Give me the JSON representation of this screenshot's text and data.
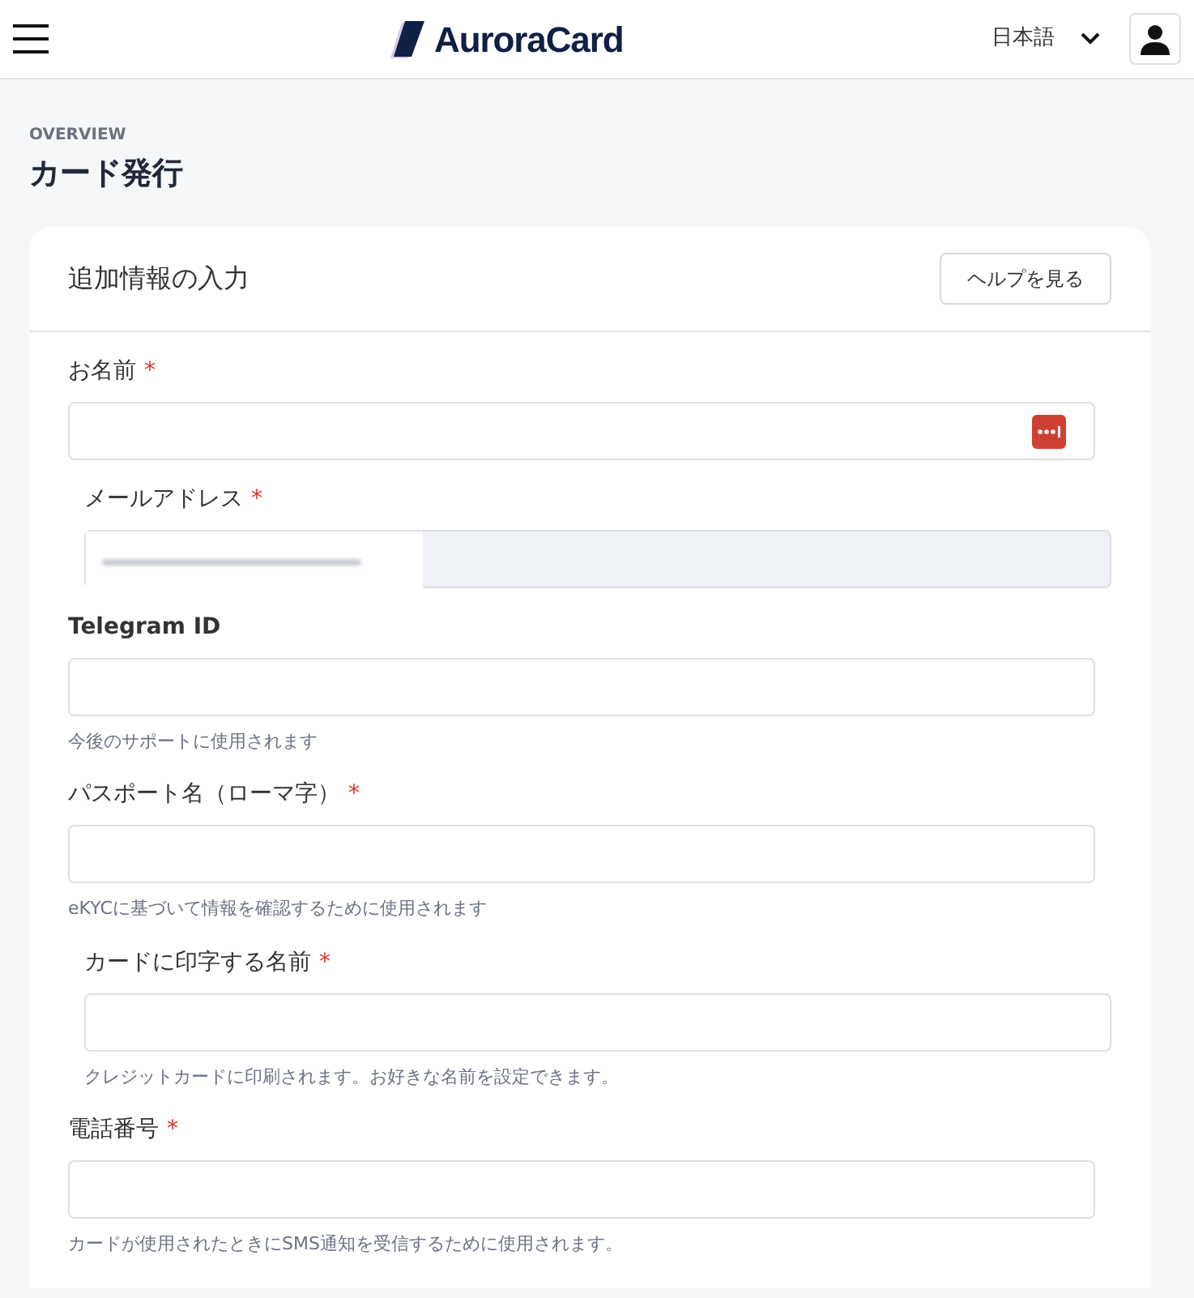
{
  "header": {
    "logo": "AuroraCard",
    "language": "日本語"
  },
  "page": {
    "eyebrow": "OVERVIEW",
    "title": "カード発行"
  },
  "card": {
    "title": "追加情報の入力",
    "help_button": "ヘルプを見る",
    "fields": [
      {
        "kind": "standard",
        "label": "お名前",
        "required_mark": "*",
        "disabled": false,
        "autofill_icon": true
      },
      {
        "kind": "inset",
        "label": "メールアドレス",
        "required_mark": "*",
        "disabled": true,
        "redacted": true
      },
      {
        "kind": "standard",
        "label": "Telegram ID",
        "disabled": false,
        "hint": "今後のサポートに使用されます"
      },
      {
        "kind": "standard",
        "label": "パスポート名（ローマ字）",
        "required_mark": "*",
        "disabled": false,
        "hint": "eKYCに基づいて情報を確認するために使用されます"
      },
      {
        "kind": "inset",
        "label": "カードに印字する名前",
        "required_mark": "*",
        "disabled": false,
        "hint": "クレジットカードに印刷されます。お好きな名前を設定できます。"
      },
      {
        "kind": "standard",
        "label": "電話番号",
        "required_mark": "*",
        "disabled": false,
        "hint": "カードが使用されたときにSMS通知を受信するために使用されます。"
      }
    ]
  }
}
